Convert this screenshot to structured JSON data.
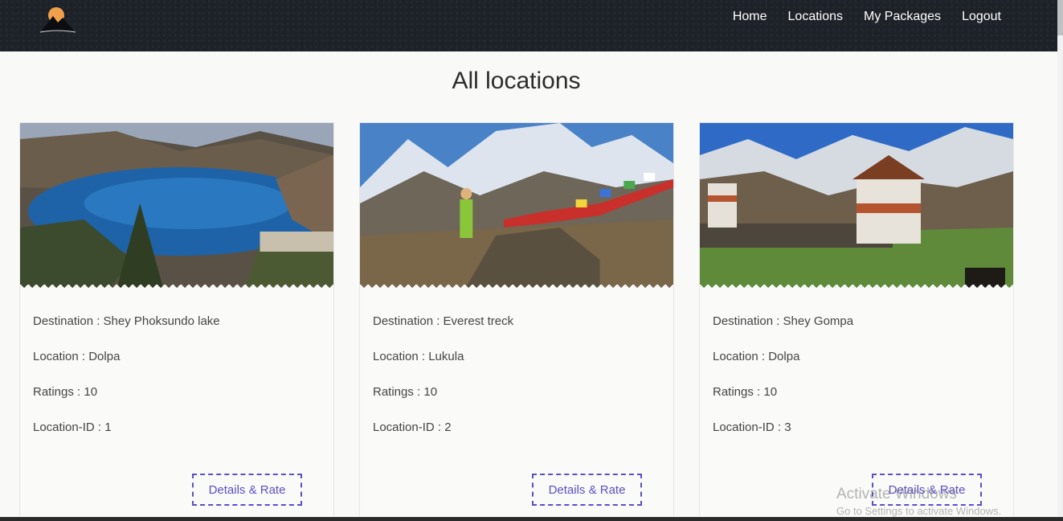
{
  "nav": {
    "links": [
      "Home",
      "Locations",
      "My Packages",
      "Logout"
    ]
  },
  "page": {
    "title": "All locations"
  },
  "cards": [
    {
      "destination": "Destination : Shey Phoksundo lake",
      "location": "Location : Dolpa",
      "ratings": "Ratings : 10",
      "location_id": "Location-ID : 1",
      "button_label": "Details & Rate"
    },
    {
      "destination": "Destination : Everest treck",
      "location": "Location : Lukula",
      "ratings": "Ratings : 10",
      "location_id": "Location-ID : 2",
      "button_label": "Details & Rate"
    },
    {
      "destination": "Destination : Shey Gompa",
      "location": "Location : Dolpa",
      "ratings": "Ratings : 10",
      "location_id": "Location-ID : 3",
      "button_label": "Details & Rate"
    }
  ],
  "watermark": {
    "line1": "Activate Windows",
    "line2": "Go to Settings to activate Windows."
  },
  "colors": {
    "navbar": "#1d2128",
    "accent": "#5b4fc8",
    "background": "#f9f9f7"
  }
}
